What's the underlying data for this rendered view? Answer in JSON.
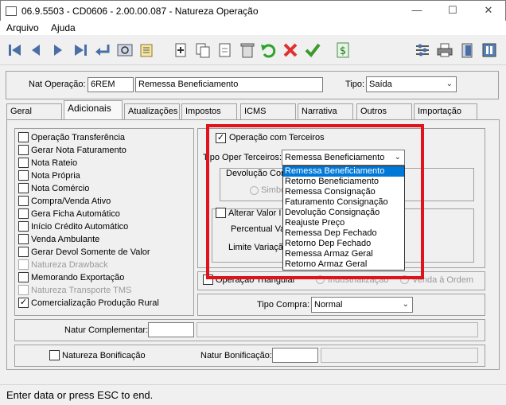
{
  "window": {
    "title": "06.9.5503 - CD0606 - 2.00.00.087 - Natureza Operação"
  },
  "menu": {
    "items": [
      "Arquivo",
      "Ajuda"
    ]
  },
  "header": {
    "nat_label": "Nat Operação:",
    "nat_code": "6REM",
    "nat_desc": "Remessa Beneficiamento",
    "tipo_label": "Tipo:",
    "tipo_value": "Saída"
  },
  "tabs": [
    "Geral",
    "Adicionais",
    "Atualizações",
    "Impostos",
    "ICMS",
    "Narrativa",
    "Outros",
    "Importação"
  ],
  "left_checks": [
    {
      "label": "Operação Transferência",
      "checked": false,
      "disabled": false
    },
    {
      "label": "Gerar Nota Faturamento",
      "checked": false,
      "disabled": false
    },
    {
      "label": "Nota Rateio",
      "checked": false,
      "disabled": false
    },
    {
      "label": "Nota Própria",
      "checked": false,
      "disabled": false
    },
    {
      "label": "Nota Comércio",
      "checked": false,
      "disabled": false
    },
    {
      "label": "Compra/Venda Ativo",
      "checked": false,
      "disabled": false
    },
    {
      "label": "Gera Ficha Automático",
      "checked": false,
      "disabled": false
    },
    {
      "label": "Início Crédito Automático",
      "checked": false,
      "disabled": false
    },
    {
      "label": "Venda Ambulante",
      "checked": false,
      "disabled": false
    },
    {
      "label": "Gerar Devol Somente de Valor",
      "checked": false,
      "disabled": false
    },
    {
      "label": "Natureza Drawback",
      "checked": false,
      "disabled": true
    },
    {
      "label": "Memorando Exportação",
      "checked": false,
      "disabled": false
    },
    {
      "label": "Natureza Transporte TMS",
      "checked": false,
      "disabled": true
    },
    {
      "label": "Comercialização Produção Rural",
      "checked": true,
      "disabled": false
    }
  ],
  "terceiros": {
    "check_label": "Operação com Terceiros",
    "tipo_label": "Tipo Oper Terceiros:",
    "tipo_value": "Remessa Beneficiamento",
    "devolucao_label": "Devolução Con",
    "simbolico": "Simbó",
    "options": [
      "Remessa Beneficiamento",
      "Retorno Beneficiamento",
      "Remessa Consignação",
      "Faturamento Consignação",
      "Devolução Consignação",
      "Reajuste Preço",
      "Remessa Dep Fechado",
      "Retorno Dep Fechado",
      "Remessa Armaz Geral",
      "Retorno Armaz Geral"
    ],
    "alterar_label": "Alterar Valor I",
    "percentual_label": "Percentual Va",
    "limite_label": "Limite Variaçã"
  },
  "triangular": {
    "label": "Operação Triangular",
    "industrializacao": "Industrialização",
    "venda_ordem": "Venda à Ordem"
  },
  "tipo_compra": {
    "label": "Tipo Compra:",
    "value": "Normal"
  },
  "natur_complementar": {
    "label": "Natur Complementar:"
  },
  "bonificacao": {
    "check_label": "Natureza Bonificação",
    "natur_label": "Natur Bonificação:"
  },
  "status": {
    "text": "Enter data or press ESC to end."
  },
  "colors": {
    "highlight": "#e0131b",
    "selection": "#0078d7"
  }
}
